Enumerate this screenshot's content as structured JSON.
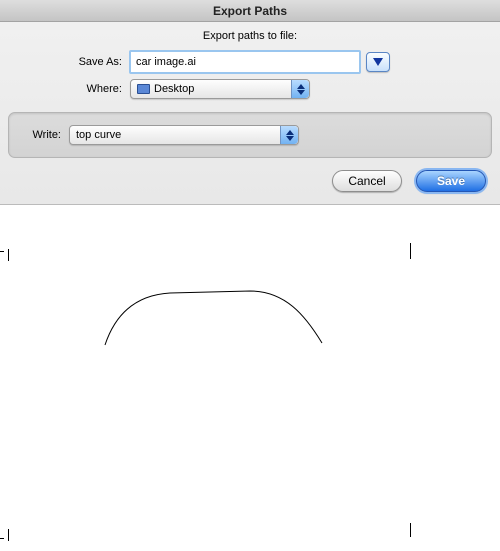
{
  "dialog": {
    "title": "Export Paths",
    "subtitle": "Export paths to file:",
    "saveAs": {
      "label": "Save As:",
      "value": "car image.ai"
    },
    "where": {
      "label": "Where:",
      "value": "Desktop"
    },
    "write": {
      "label": "Write:",
      "value": "top curve"
    },
    "buttons": {
      "cancel": "Cancel",
      "save": "Save"
    }
  }
}
